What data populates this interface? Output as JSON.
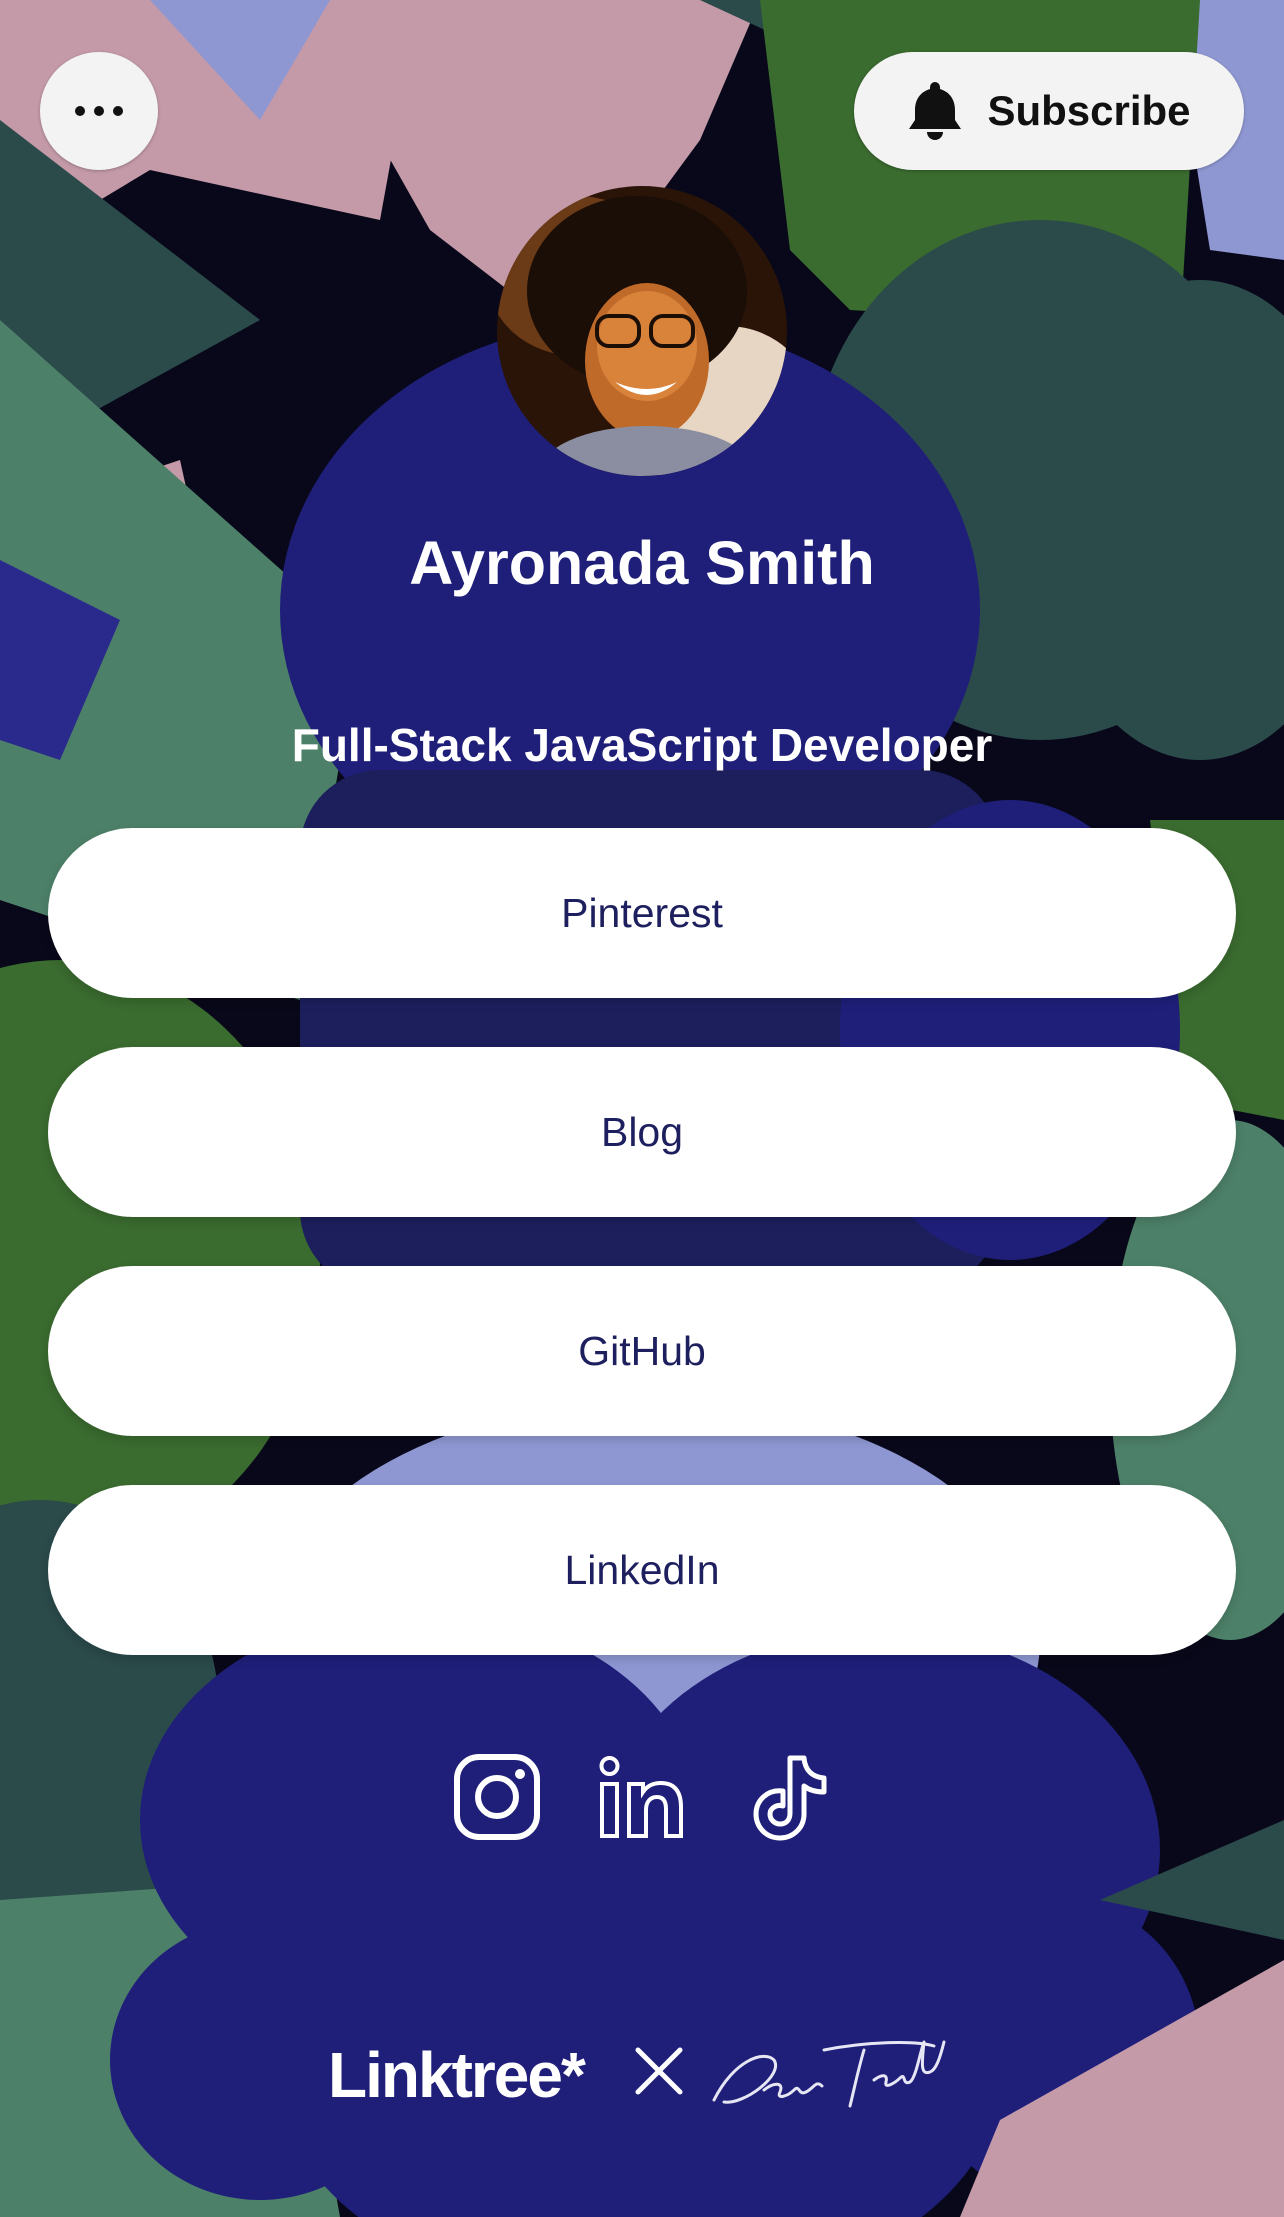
{
  "theme": {
    "colors": {
      "navy": "#1f1f7a",
      "lavender": "#8e97d2",
      "pink": "#c49aa8",
      "green": "#3a6b2f",
      "teal": "#2b4a4a",
      "sage": "#4d8068",
      "black": "#08081a",
      "button_text": "#1d1f5e"
    }
  },
  "header": {
    "more_icon": "more-horizontal-icon",
    "subscribe_icon": "bell-icon",
    "subscribe_label": "Subscribe"
  },
  "profile": {
    "name": "Ayronada Smith",
    "bio": "Full-Stack JavaScript Developer"
  },
  "links": [
    {
      "label": "Pinterest"
    },
    {
      "label": "Blog"
    },
    {
      "label": "GitHub"
    },
    {
      "label": "LinkedIn"
    }
  ],
  "socials": [
    {
      "icon": "instagram-icon"
    },
    {
      "icon": "linkedin-icon"
    },
    {
      "icon": "tiktok-icon"
    }
  ],
  "footer": {
    "logo_text": "Linktree*",
    "collab_icon": "times-icon",
    "signature_icon": "daniel-triendl-signature-icon"
  }
}
